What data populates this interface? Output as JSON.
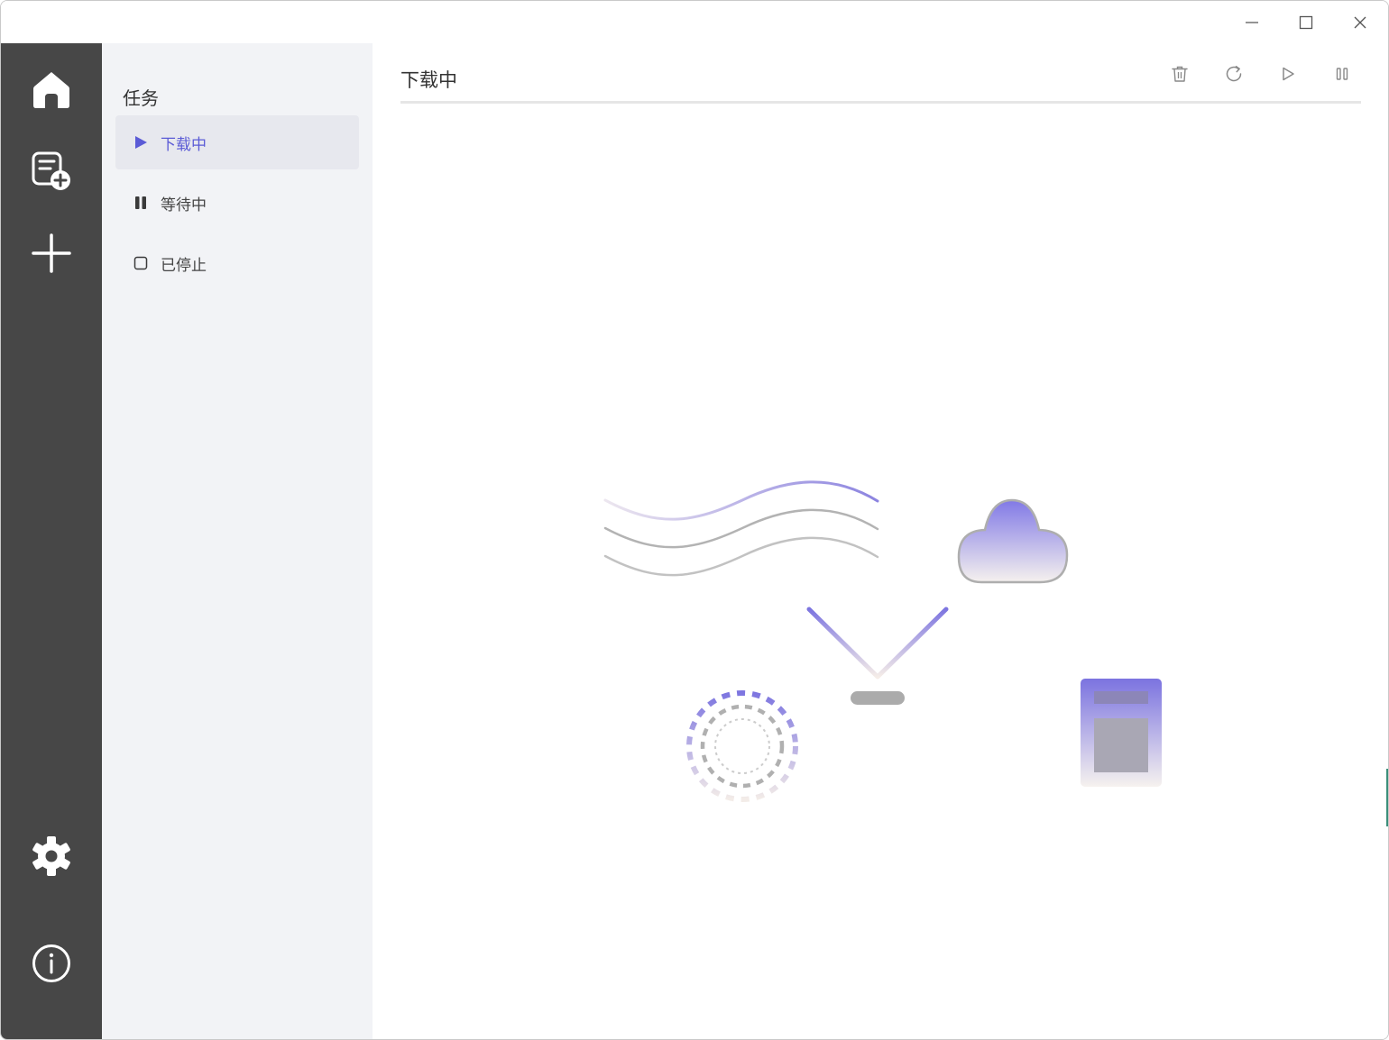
{
  "window": {
    "controls": [
      "minimize",
      "maximize",
      "close"
    ]
  },
  "rail": {
    "top": [
      {
        "name": "home",
        "icon": "home-icon"
      },
      {
        "name": "new-task",
        "icon": "list-add-icon"
      },
      {
        "name": "add",
        "icon": "plus-icon"
      }
    ],
    "bottom": [
      {
        "name": "settings",
        "icon": "gear-icon"
      },
      {
        "name": "about",
        "icon": "info-icon"
      }
    ]
  },
  "subnav": {
    "title": "任务",
    "items": [
      {
        "label": "下载中",
        "icon": "play-icon",
        "active": true
      },
      {
        "label": "等待中",
        "icon": "pause-icon",
        "active": false
      },
      {
        "label": "已停止",
        "icon": "stop-icon",
        "active": false
      }
    ]
  },
  "main": {
    "title": "下载中",
    "toolbar": [
      "delete-icon",
      "refresh-icon",
      "play-icon",
      "pause-icon"
    ]
  },
  "colors": {
    "accent": "#5b5bd6",
    "rail": "#474747",
    "subnav": "#f2f3f6"
  }
}
